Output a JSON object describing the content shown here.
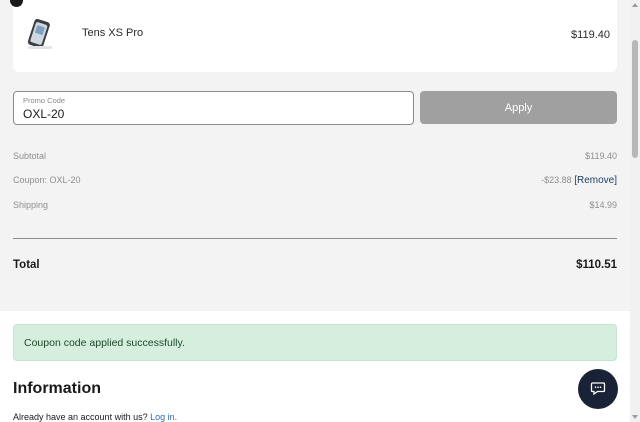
{
  "cart": {
    "items": [
      {
        "name": "Tens XS Pro",
        "price": "$119.40",
        "thumbnail_icon": "sunglasses-case-product-icon"
      }
    ]
  },
  "promo": {
    "label": "Promo Code",
    "value": "OXL-20",
    "apply_label": "Apply"
  },
  "summary": {
    "subtotal_label": "Subtotal",
    "subtotal_value": "$119.40",
    "coupon_label": "Coupon: OXL-20",
    "coupon_value": "-$23.88",
    "remove_label": "[Remove]",
    "shipping_label": "Shipping",
    "shipping_value": "$14.99",
    "total_label": "Total",
    "total_value": "$110.51"
  },
  "alert": {
    "message": "Coupon code applied successfully."
  },
  "information": {
    "heading": "Information",
    "account_prompt": "Already have an account with us?",
    "login_label": "Log in."
  },
  "chat": {
    "icon": "chat-bubble-icon"
  },
  "colors": {
    "summary_background": "#f3f3f3",
    "apply_button": "#a0a0a0",
    "success_background": "#d6eedd",
    "chat_button": "#1a2238",
    "link": "#2a6db0"
  }
}
